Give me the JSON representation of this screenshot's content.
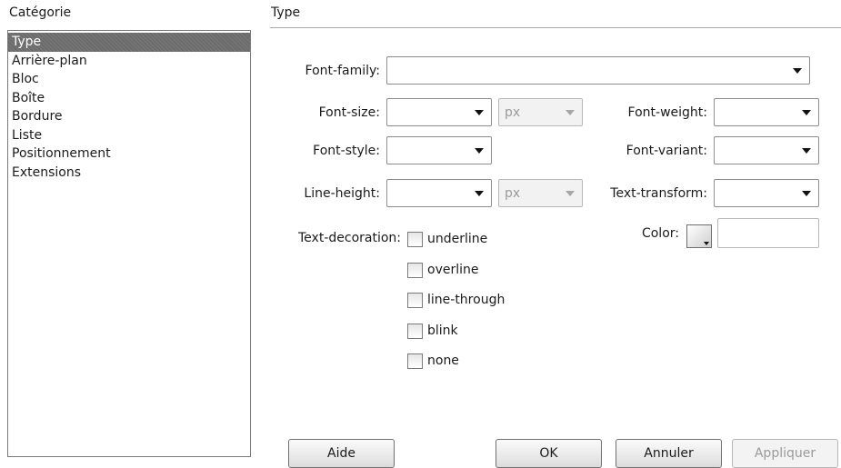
{
  "category": {
    "label": "Catégorie",
    "items": [
      "Type",
      "Arrière-plan",
      "Bloc",
      "Boîte",
      "Bordure",
      "Liste",
      "Positionnement",
      "Extensions"
    ],
    "selected": "Type"
  },
  "section": {
    "title": "Type"
  },
  "fields": {
    "font_family": {
      "label": "Font-family:",
      "value": ""
    },
    "font_size": {
      "label": "Font-size:",
      "value": "",
      "unit": "px"
    },
    "font_weight": {
      "label": "Font-weight:",
      "value": ""
    },
    "font_style": {
      "label": "Font-style:",
      "value": ""
    },
    "font_variant": {
      "label": "Font-variant:",
      "value": ""
    },
    "line_height": {
      "label": "Line-height:",
      "value": "",
      "unit": "px"
    },
    "text_transform": {
      "label": "Text-transform:",
      "value": ""
    },
    "color": {
      "label": "Color:",
      "value": ""
    }
  },
  "text_decoration": {
    "label": "Text-decoration:",
    "options": [
      {
        "label": "underline",
        "checked": false
      },
      {
        "label": "overline",
        "checked": false
      },
      {
        "label": "line-through",
        "checked": false
      },
      {
        "label": "blink",
        "checked": false
      },
      {
        "label": "none",
        "checked": false
      }
    ]
  },
  "buttons": {
    "help": "Aide",
    "ok": "OK",
    "cancel": "Annuler",
    "apply": "Appliquer"
  },
  "colors": {
    "selection_bg": "#6b6b6b",
    "selection_text": "#ffffff",
    "border": "#8c8c8c"
  },
  "icons": {
    "dropdown": "chevron-down-icon",
    "color_picker": "color-picker-icon"
  }
}
